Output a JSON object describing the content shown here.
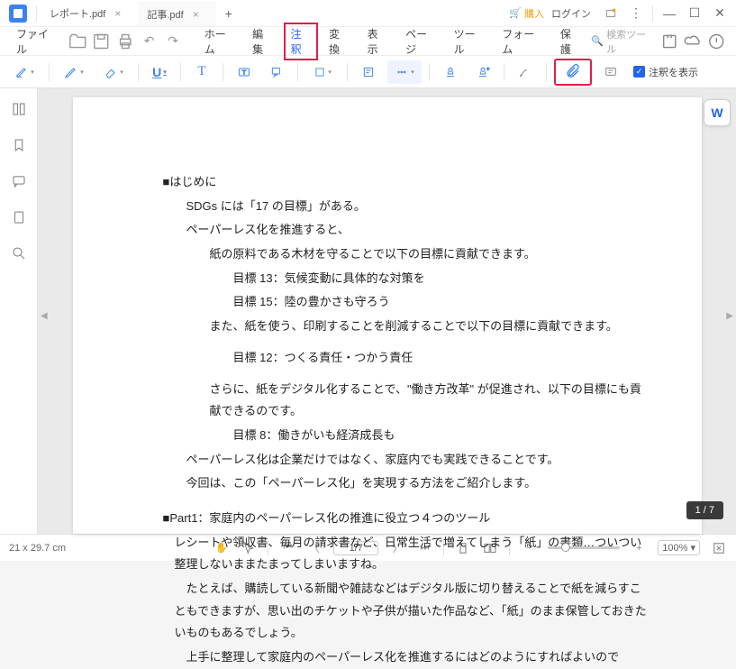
{
  "titlebar": {
    "tabs": [
      {
        "label": "レポート.pdf"
      },
      {
        "label": "記事.pdf"
      }
    ],
    "purchase": "購入",
    "login": "ログイン"
  },
  "menubar": {
    "file": "ファイル",
    "items": [
      "ホーム",
      "編集",
      "注釈",
      "変換",
      "表示",
      "ページ",
      "ツール",
      "フォーム",
      "保護"
    ],
    "search_tools": "検索ツール"
  },
  "toolbar": {
    "show_annotations": "注釈を表示"
  },
  "document": {
    "h1": "■はじめに",
    "p1": "SDGs には「17 の目標」がある。",
    "p2": "ペーパーレス化を推進すると、",
    "p3": "紙の原料である木材を守ることで以下の目標に貢献できます。",
    "p4": "目標 13：気候変動に具体的な対策を",
    "p5": "目標 15：陸の豊かさも守ろう",
    "p6": "また、紙を使う、印刷することを削減することで以下の目標に貢献できます。",
    "p7": "目標 12：つくる責任・つかう責任",
    "p8": "さらに、紙をデジタル化することで、\"働き方改革\" が促進され、以下の目標にも貢献できるのです。",
    "p9": "目標 8：働きがいも経済成長も",
    "p10": "ペーパーレス化は企業だけではなく、家庭内でも実践できることです。",
    "p11": "今回は、この「ペーパーレス化」を実現する方法をご紹介します。",
    "h2": "■Part1：家庭内のペーパーレス化の推進に役立つ４つのツール",
    "p12": "レシートや領収書、毎月の請求書など、日常生活で増えてしまう「紙」の書類…ついつい整理しないままたまってしまいますね。",
    "p13": "たとえば、購読している新聞や雑誌などはデジタル版に切り替えることで紙を減らすこともできますが、思い出のチケットや子供が描いた作品など、「紙」のまま保管しておきたいものもあるでしょう。",
    "p14": "上手に整理して家庭内のペーパーレス化を推進するにはどのようにすればよいので"
  },
  "status": {
    "dimensions": "21 x 29.7 cm",
    "page": "1/7",
    "zoom": "100%"
  },
  "page_indicator": "1 / 7"
}
